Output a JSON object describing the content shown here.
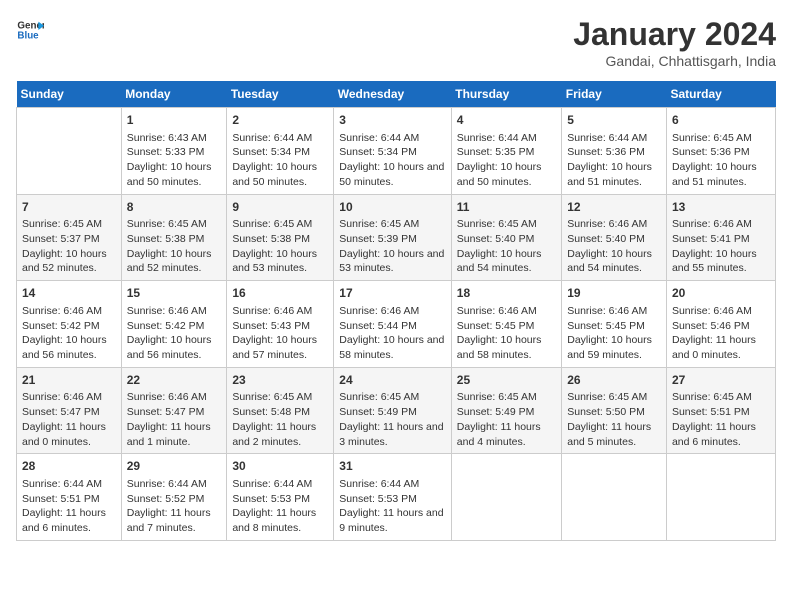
{
  "header": {
    "logo_line1": "General",
    "logo_line2": "Blue",
    "month": "January 2024",
    "location": "Gandai, Chhattisgarh, India"
  },
  "weekdays": [
    "Sunday",
    "Monday",
    "Tuesday",
    "Wednesday",
    "Thursday",
    "Friday",
    "Saturday"
  ],
  "weeks": [
    [
      {
        "day": "",
        "sunrise": "",
        "sunset": "",
        "daylight": ""
      },
      {
        "day": "1",
        "sunrise": "Sunrise: 6:43 AM",
        "sunset": "Sunset: 5:33 PM",
        "daylight": "Daylight: 10 hours and 50 minutes."
      },
      {
        "day": "2",
        "sunrise": "Sunrise: 6:44 AM",
        "sunset": "Sunset: 5:34 PM",
        "daylight": "Daylight: 10 hours and 50 minutes."
      },
      {
        "day": "3",
        "sunrise": "Sunrise: 6:44 AM",
        "sunset": "Sunset: 5:34 PM",
        "daylight": "Daylight: 10 hours and 50 minutes."
      },
      {
        "day": "4",
        "sunrise": "Sunrise: 6:44 AM",
        "sunset": "Sunset: 5:35 PM",
        "daylight": "Daylight: 10 hours and 50 minutes."
      },
      {
        "day": "5",
        "sunrise": "Sunrise: 6:44 AM",
        "sunset": "Sunset: 5:36 PM",
        "daylight": "Daylight: 10 hours and 51 minutes."
      },
      {
        "day": "6",
        "sunrise": "Sunrise: 6:45 AM",
        "sunset": "Sunset: 5:36 PM",
        "daylight": "Daylight: 10 hours and 51 minutes."
      }
    ],
    [
      {
        "day": "7",
        "sunrise": "Sunrise: 6:45 AM",
        "sunset": "Sunset: 5:37 PM",
        "daylight": "Daylight: 10 hours and 52 minutes."
      },
      {
        "day": "8",
        "sunrise": "Sunrise: 6:45 AM",
        "sunset": "Sunset: 5:38 PM",
        "daylight": "Daylight: 10 hours and 52 minutes."
      },
      {
        "day": "9",
        "sunrise": "Sunrise: 6:45 AM",
        "sunset": "Sunset: 5:38 PM",
        "daylight": "Daylight: 10 hours and 53 minutes."
      },
      {
        "day": "10",
        "sunrise": "Sunrise: 6:45 AM",
        "sunset": "Sunset: 5:39 PM",
        "daylight": "Daylight: 10 hours and 53 minutes."
      },
      {
        "day": "11",
        "sunrise": "Sunrise: 6:45 AM",
        "sunset": "Sunset: 5:40 PM",
        "daylight": "Daylight: 10 hours and 54 minutes."
      },
      {
        "day": "12",
        "sunrise": "Sunrise: 6:46 AM",
        "sunset": "Sunset: 5:40 PM",
        "daylight": "Daylight: 10 hours and 54 minutes."
      },
      {
        "day": "13",
        "sunrise": "Sunrise: 6:46 AM",
        "sunset": "Sunset: 5:41 PM",
        "daylight": "Daylight: 10 hours and 55 minutes."
      }
    ],
    [
      {
        "day": "14",
        "sunrise": "Sunrise: 6:46 AM",
        "sunset": "Sunset: 5:42 PM",
        "daylight": "Daylight: 10 hours and 56 minutes."
      },
      {
        "day": "15",
        "sunrise": "Sunrise: 6:46 AM",
        "sunset": "Sunset: 5:42 PM",
        "daylight": "Daylight: 10 hours and 56 minutes."
      },
      {
        "day": "16",
        "sunrise": "Sunrise: 6:46 AM",
        "sunset": "Sunset: 5:43 PM",
        "daylight": "Daylight: 10 hours and 57 minutes."
      },
      {
        "day": "17",
        "sunrise": "Sunrise: 6:46 AM",
        "sunset": "Sunset: 5:44 PM",
        "daylight": "Daylight: 10 hours and 58 minutes."
      },
      {
        "day": "18",
        "sunrise": "Sunrise: 6:46 AM",
        "sunset": "Sunset: 5:45 PM",
        "daylight": "Daylight: 10 hours and 58 minutes."
      },
      {
        "day": "19",
        "sunrise": "Sunrise: 6:46 AM",
        "sunset": "Sunset: 5:45 PM",
        "daylight": "Daylight: 10 hours and 59 minutes."
      },
      {
        "day": "20",
        "sunrise": "Sunrise: 6:46 AM",
        "sunset": "Sunset: 5:46 PM",
        "daylight": "Daylight: 11 hours and 0 minutes."
      }
    ],
    [
      {
        "day": "21",
        "sunrise": "Sunrise: 6:46 AM",
        "sunset": "Sunset: 5:47 PM",
        "daylight": "Daylight: 11 hours and 0 minutes."
      },
      {
        "day": "22",
        "sunrise": "Sunrise: 6:46 AM",
        "sunset": "Sunset: 5:47 PM",
        "daylight": "Daylight: 11 hours and 1 minute."
      },
      {
        "day": "23",
        "sunrise": "Sunrise: 6:45 AM",
        "sunset": "Sunset: 5:48 PM",
        "daylight": "Daylight: 11 hours and 2 minutes."
      },
      {
        "day": "24",
        "sunrise": "Sunrise: 6:45 AM",
        "sunset": "Sunset: 5:49 PM",
        "daylight": "Daylight: 11 hours and 3 minutes."
      },
      {
        "day": "25",
        "sunrise": "Sunrise: 6:45 AM",
        "sunset": "Sunset: 5:49 PM",
        "daylight": "Daylight: 11 hours and 4 minutes."
      },
      {
        "day": "26",
        "sunrise": "Sunrise: 6:45 AM",
        "sunset": "Sunset: 5:50 PM",
        "daylight": "Daylight: 11 hours and 5 minutes."
      },
      {
        "day": "27",
        "sunrise": "Sunrise: 6:45 AM",
        "sunset": "Sunset: 5:51 PM",
        "daylight": "Daylight: 11 hours and 6 minutes."
      }
    ],
    [
      {
        "day": "28",
        "sunrise": "Sunrise: 6:44 AM",
        "sunset": "Sunset: 5:51 PM",
        "daylight": "Daylight: 11 hours and 6 minutes."
      },
      {
        "day": "29",
        "sunrise": "Sunrise: 6:44 AM",
        "sunset": "Sunset: 5:52 PM",
        "daylight": "Daylight: 11 hours and 7 minutes."
      },
      {
        "day": "30",
        "sunrise": "Sunrise: 6:44 AM",
        "sunset": "Sunset: 5:53 PM",
        "daylight": "Daylight: 11 hours and 8 minutes."
      },
      {
        "day": "31",
        "sunrise": "Sunrise: 6:44 AM",
        "sunset": "Sunset: 5:53 PM",
        "daylight": "Daylight: 11 hours and 9 minutes."
      },
      {
        "day": "",
        "sunrise": "",
        "sunset": "",
        "daylight": ""
      },
      {
        "day": "",
        "sunrise": "",
        "sunset": "",
        "daylight": ""
      },
      {
        "day": "",
        "sunrise": "",
        "sunset": "",
        "daylight": ""
      }
    ]
  ]
}
